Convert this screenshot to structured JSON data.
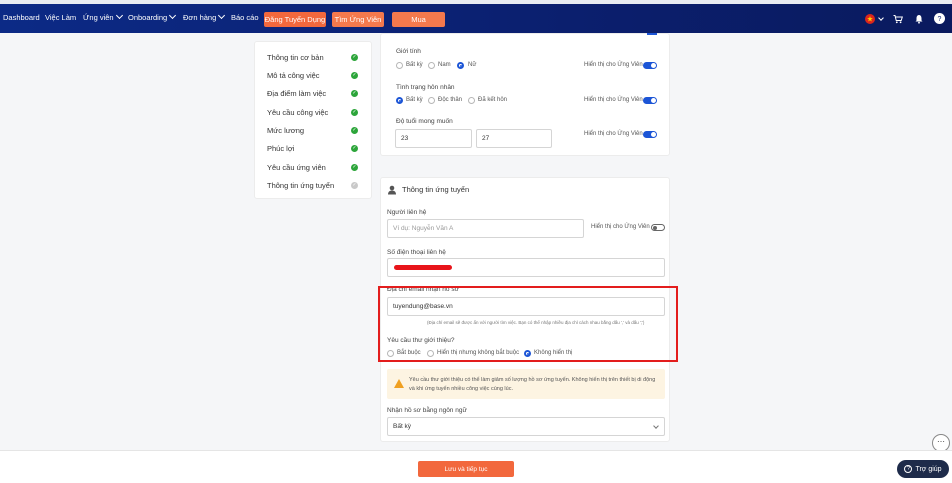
{
  "navbar": {
    "items": [
      {
        "label": "Dashboard",
        "dropdown": false
      },
      {
        "label": "Việc Làm",
        "dropdown": false
      },
      {
        "label": "Ứng viên",
        "dropdown": true
      },
      {
        "label": "Onboarding",
        "dropdown": true
      },
      {
        "label": "Đơn hàng",
        "dropdown": true
      },
      {
        "label": "Báo cáo",
        "dropdown": false
      }
    ],
    "post_job_label": "Đăng Tuyển Dụng",
    "find_candidate_label": "Tìm Ứng Viên",
    "buy_label": "Mua",
    "icons": [
      "flag-vn-icon",
      "cart-icon",
      "bell-icon",
      "help-circle-icon"
    ]
  },
  "steps": [
    {
      "label": "Thông tin cơ bản",
      "done": true
    },
    {
      "label": "Mô tả công việc",
      "done": true
    },
    {
      "label": "Địa điểm làm việc",
      "done": true
    },
    {
      "label": "Yêu cầu công việc",
      "done": true
    },
    {
      "label": "Mức lương",
      "done": true
    },
    {
      "label": "Phúc lợi",
      "done": true
    },
    {
      "label": "Yêu cầu ứng viên",
      "done": true
    },
    {
      "label": "Thông tin ứng tuyển",
      "done": false
    }
  ],
  "candidate_requirements": {
    "gender": {
      "label": "Giới tính",
      "options": [
        "Bất kỳ",
        "Nam",
        "Nữ"
      ],
      "selected": "Nữ"
    },
    "marital": {
      "label": "Tình trạng hôn nhân",
      "options": [
        "Bất kỳ",
        "Độc thân",
        "Đã kết hôn"
      ],
      "selected": "Bất kỳ"
    },
    "age": {
      "label": "Độ tuổi mong muốn",
      "min": "23",
      "max": "27"
    },
    "show_to_candidate_label": "Hiển thị cho Ứng Viên"
  },
  "application_info": {
    "title": "Thông tin ứng tuyển",
    "contact_person_label": "Người liên hệ",
    "contact_person_placeholder": "Ví dụ: Nguyễn Văn A",
    "show_to_candidate_label": "Hiển thị cho Ứng Viên",
    "phone_label": "Số điện thoại liên hệ",
    "email_label": "Địa chỉ email nhận hồ sơ",
    "email_value": "tuyendung@base.vn",
    "email_hint": "(Địa chỉ email sẽ được ẩn với người tìm việc. Bạn có thể nhập nhiều địa chỉ cách nhau bằng dấu ',' và dấu ';')",
    "cover_letter": {
      "label": "Yêu cầu thư giới thiệu?",
      "options": [
        "Bắt buộc",
        "Hiển thị nhưng không bắt buộc",
        "Không hiển thị"
      ],
      "selected": "Không hiển thị"
    },
    "warning": "Yêu cầu thư giới thiệu có thể làm giảm số lượng hồ sơ ứng tuyển. Không hiển thị trên thiết bị di động và khi ứng tuyển nhiều công việc cùng lúc.",
    "language_label": "Nhận hồ sơ bằng ngôn ngữ",
    "language_value": "Bất kỳ"
  },
  "footer": {
    "save_label": "Lưu và tiếp tục",
    "help_label": "Trợ giúp"
  },
  "colors": {
    "navbar": "#0c2a86",
    "accent": "#f2683d",
    "toggle_on": "#1c55d6",
    "check": "#2ca53a",
    "highlight": "#e31d1d"
  }
}
